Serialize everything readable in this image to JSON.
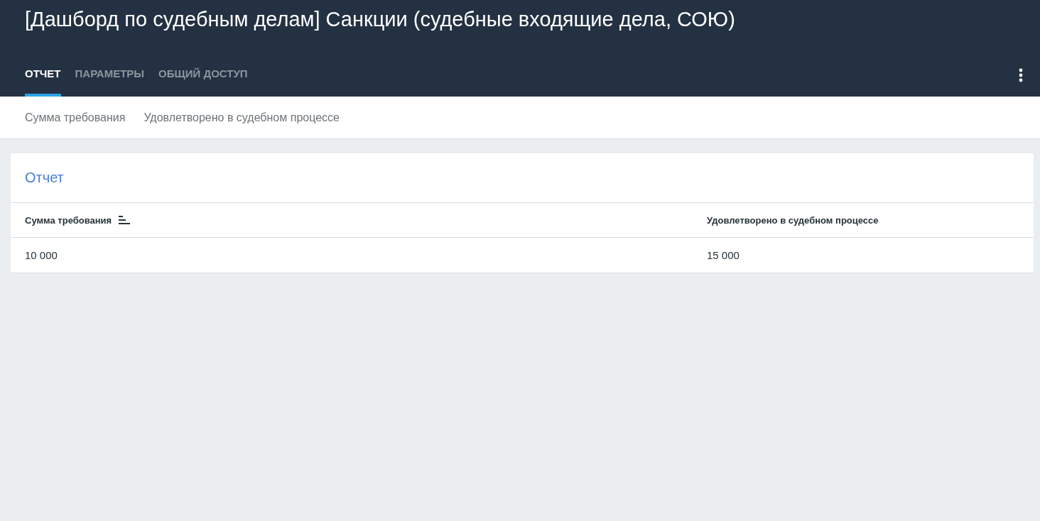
{
  "header": {
    "title": "[Дашборд по судебным делам] Санкции (судебные входящие дела, СОЮ)"
  },
  "tabs": [
    {
      "label": "ОТЧЕТ",
      "selected": true
    },
    {
      "label": "ПАРАМЕТРЫ",
      "selected": false
    },
    {
      "label": "ОБЩИЙ ДОСТУП",
      "selected": false
    }
  ],
  "filters": [
    "Сумма требования",
    "Удовлетворено в судебном процессе"
  ],
  "report": {
    "title": "Отчет",
    "columns": [
      {
        "label": "Сумма требования",
        "sorted": true
      },
      {
        "label": "Удовлетворено в судебном процессе",
        "sorted": false
      }
    ],
    "rows": [
      [
        "10 000",
        "15 000"
      ]
    ]
  }
}
